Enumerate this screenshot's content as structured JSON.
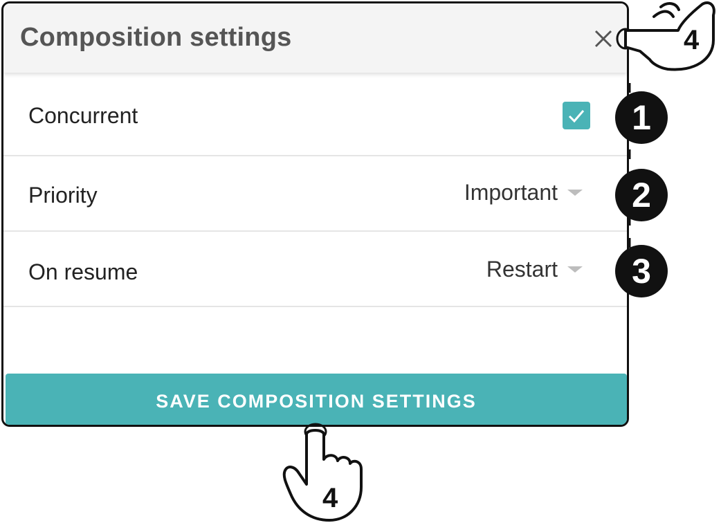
{
  "dialog": {
    "title": "Composition settings",
    "close_icon": "close-icon",
    "rows": [
      {
        "label": "Concurrent",
        "control": "checkbox",
        "checked": true
      },
      {
        "label": "Priority",
        "control": "select",
        "value": "Important"
      },
      {
        "label": "On resume",
        "control": "select",
        "value": "Restart"
      }
    ],
    "save_label": "SAVE COMPOSITION SETTINGS"
  },
  "annotations": {
    "steps": [
      "1",
      "2",
      "3"
    ],
    "hand_step": "4"
  },
  "colors": {
    "accent": "#4ab3b6",
    "header_bg": "#f4f4f4",
    "title_text": "#555555",
    "badge": "#111111"
  }
}
